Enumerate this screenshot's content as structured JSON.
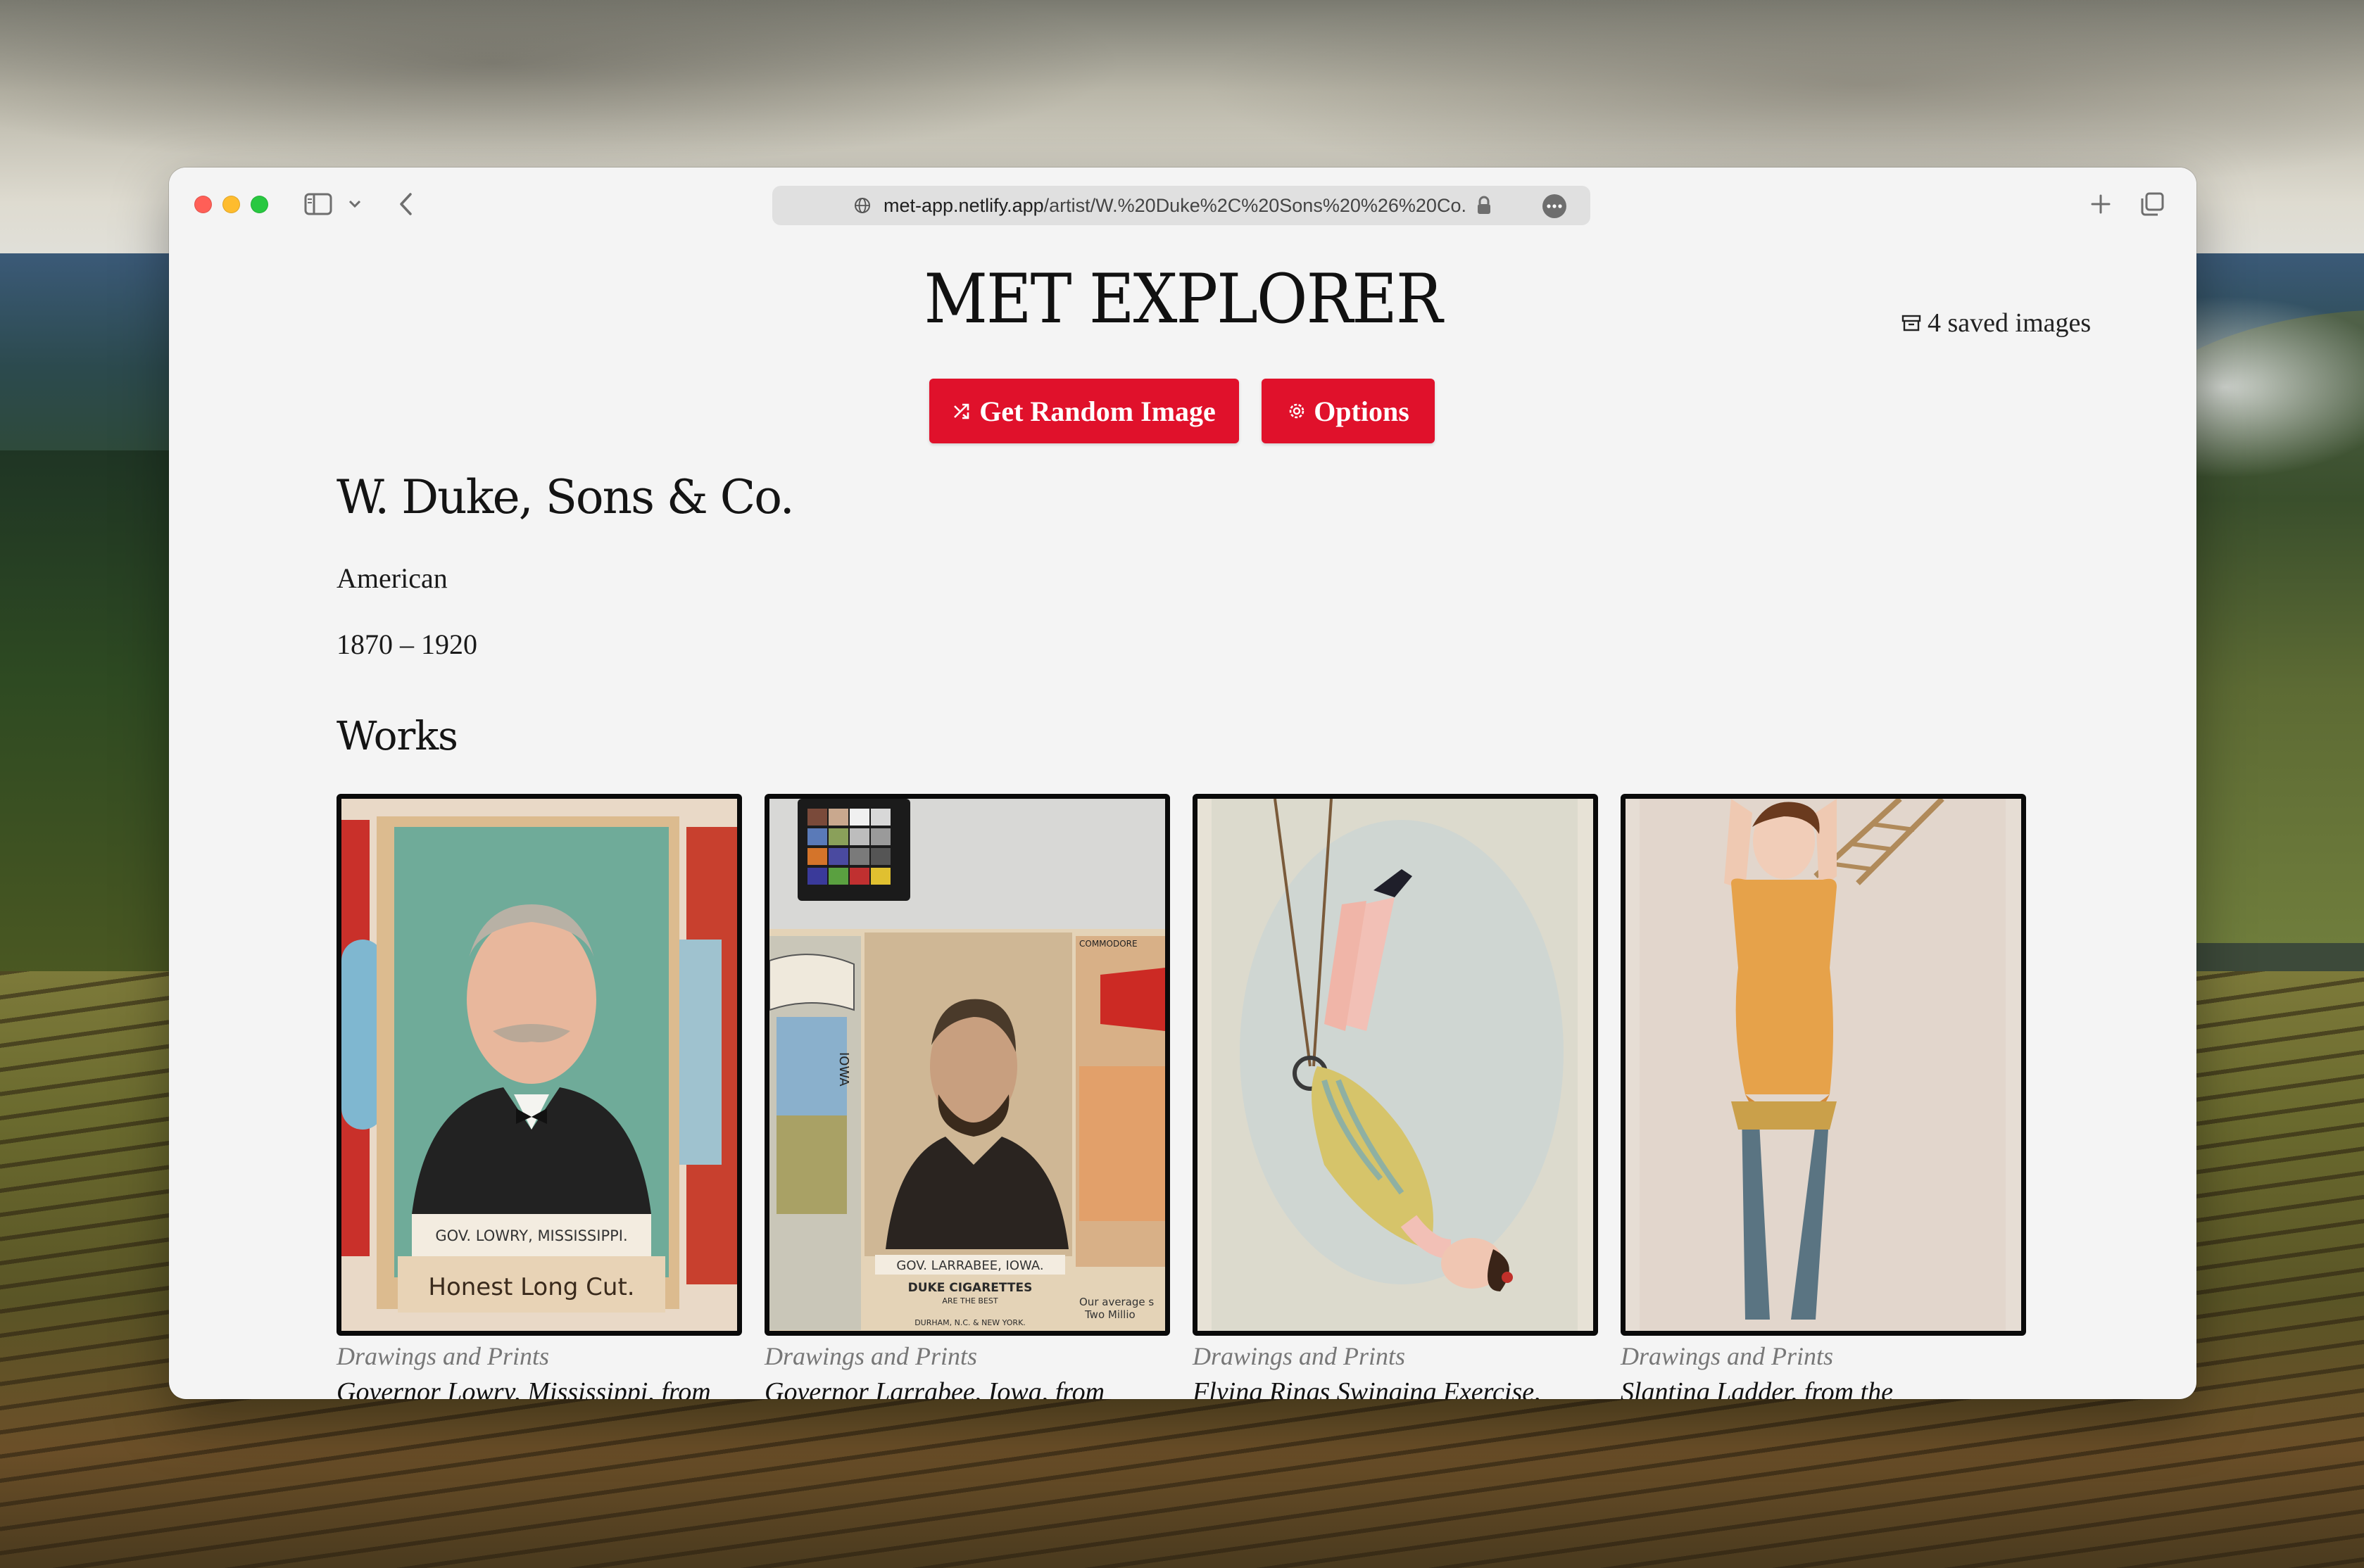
{
  "browser": {
    "url_host": "met-app.netlify.app",
    "url_path": "/artist/W.%20Duke%2C%20Sons%20%26%20Co."
  },
  "header": {
    "site_title": "MET EXPLORER",
    "saved_label": "4 saved images",
    "random_button": "Get Random Image",
    "options_button": "Options"
  },
  "artist": {
    "name": "W. Duke, Sons & Co.",
    "nationality": "American",
    "dates": "1870 – 1920"
  },
  "works": {
    "heading": "Works",
    "items": [
      {
        "department": "Drawings and Prints",
        "title": "Governor Lowry, Mississippi, from",
        "card_text_1": "GOV. LOWRY, MISSISSIPPI.",
        "card_text_2": "Honest Long Cut."
      },
      {
        "department": "Drawings and Prints",
        "title": "Governor Larrabee, Iowa, from",
        "card_text_1": "GOV. LARRABEE, IOWA.",
        "card_text_2": "DUKE CIGARETTES",
        "card_text_3": "ARE THE BEST",
        "card_text_4": "DURHAM, N.C. & NEW YORK.",
        "card_text_5": "IOWA",
        "card_text_6": "COMMODORE",
        "card_text_7": "Our average s",
        "card_text_8": "Two Millio"
      },
      {
        "department": "Drawings and Prints",
        "title": "Flying Rings Swinging Exercise,"
      },
      {
        "department": "Drawings and Prints",
        "title": "Slanting Ladder, from the"
      }
    ]
  },
  "colors": {
    "accent": "#e0112b",
    "page_bg": "#f4f4f4"
  }
}
